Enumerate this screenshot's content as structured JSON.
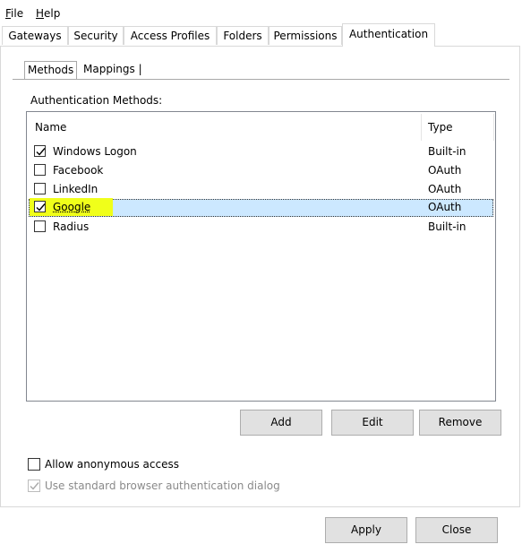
{
  "menu": {
    "file": "File",
    "help": "Help"
  },
  "tabs": [
    "Gateways",
    "Security",
    "Access Profiles",
    "Folders",
    "Permissions",
    "Authentication"
  ],
  "subtabs": [
    "Methods",
    "Mappings"
  ],
  "section_label": "Authentication Methods:",
  "list": {
    "columns": {
      "name": "Name",
      "type": "Type"
    },
    "rows": [
      {
        "name": "Windows Logon",
        "type": "Built-in",
        "checked": true
      },
      {
        "name": "Facebook",
        "type": "OAuth",
        "checked": false
      },
      {
        "name": "LinkedIn",
        "type": "OAuth",
        "checked": false
      },
      {
        "name": "Google",
        "type": "OAuth",
        "checked": true,
        "selected": true
      },
      {
        "name": "Radius",
        "type": "Built-in",
        "checked": false
      }
    ]
  },
  "buttons": {
    "add": "Add",
    "edit": "Edit",
    "remove": "Remove",
    "apply": "Apply",
    "close": "Close"
  },
  "options": {
    "allow_anonymous": "Allow anonymous access",
    "standard_browser": "Use standard browser authentication dialog"
  },
  "colors": {
    "highlight": "#f0ff1a",
    "selection": "#cce8ff"
  }
}
